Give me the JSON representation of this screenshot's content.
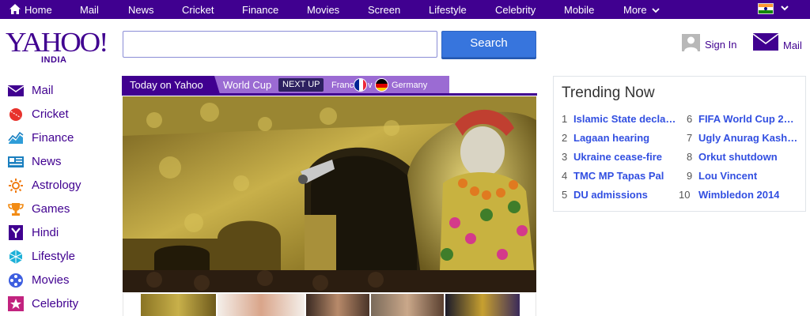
{
  "topnav": {
    "items": [
      "Home",
      "Mail",
      "News",
      "Cricket",
      "Finance",
      "Movies",
      "Screen",
      "Lifestyle",
      "Celebrity",
      "Mobile",
      "More"
    ]
  },
  "brand": {
    "logo": "YAHOO!",
    "region": "INDIA"
  },
  "search": {
    "value": "",
    "button": "Search"
  },
  "account": {
    "signin": "Sign In",
    "mail": "Mail"
  },
  "sidebar": {
    "items": [
      "Mail",
      "Cricket",
      "Finance",
      "News",
      "Astrology",
      "Games",
      "Hindi",
      "Lifestyle",
      "Movies",
      "Celebrity"
    ]
  },
  "tabs": {
    "today": "Today on Yahoo",
    "worldcup": "World Cup",
    "next_up": "NEXT UP",
    "team1": "France",
    "vs": "v",
    "team2": "Germany"
  },
  "trending": {
    "title": "Trending Now",
    "items": [
      {
        "num": "1",
        "text": "Islamic State decla…"
      },
      {
        "num": "2",
        "text": "Lagaan hearing"
      },
      {
        "num": "3",
        "text": "Ukraine cease-fire"
      },
      {
        "num": "4",
        "text": "TMC MP Tapas Pal"
      },
      {
        "num": "5",
        "text": "DU admissions"
      },
      {
        "num": "6",
        "text": "FIFA World Cup 2…"
      },
      {
        "num": "7",
        "text": "Ugly Anurag Kash…"
      },
      {
        "num": "8",
        "text": "Orkut shutdown"
      },
      {
        "num": "9",
        "text": "Lou Vincent"
      },
      {
        "num": "10",
        "text": "Wimbledon 2014"
      }
    ]
  },
  "colors": {
    "brand_purple": "#400090",
    "search_blue": "#3775dd",
    "link_blue": "#324fe1",
    "tab_light": "#9b6bd3"
  }
}
